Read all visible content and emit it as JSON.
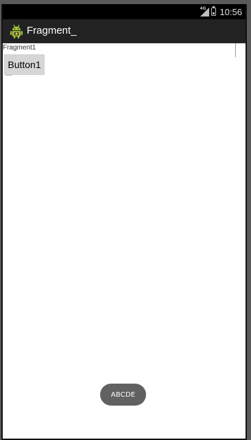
{
  "status_bar": {
    "network_type": "4G",
    "time": "10:56"
  },
  "action_bar": {
    "title": "Fragment_",
    "icon": "android-icon"
  },
  "fragment": {
    "label": "Fragment1",
    "button_label": "Button1"
  },
  "toast": {
    "message": "ABCDE"
  },
  "colors": {
    "status_bar_bg": "#000000",
    "action_bar_bg": "#222222",
    "content_bg": "#ffffff",
    "android_green": "#a4c639",
    "toast_bg": "#616161",
    "button_bg": "#d6d6d6"
  }
}
